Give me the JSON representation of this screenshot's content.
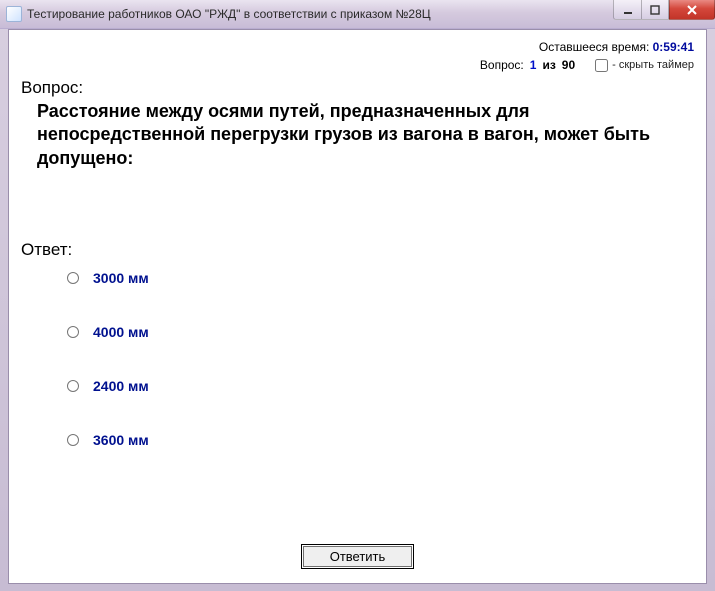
{
  "window": {
    "title": "Тестирование работников ОАО \"РЖД\" в соответствии с приказом №28Ц"
  },
  "meta": {
    "time_label": "Оставшееся время:",
    "time_value": "0:59:41",
    "question_label": "Вопрос:",
    "question_current": "1",
    "question_of": "из",
    "question_total": "90",
    "hide_timer_label": "- скрыть таймер",
    "hide_timer_checked": false
  },
  "question": {
    "label": "Вопрос:",
    "text": "Расстояние между осями путей, предназначенных для непосредственной перегрузки грузов из вагона в вагон, может быть допущено:"
  },
  "answer_label": "Ответ:",
  "answers": [
    {
      "text": "3000 мм"
    },
    {
      "text": "4000 мм"
    },
    {
      "text": "2400 мм"
    },
    {
      "text": "3600 мм"
    }
  ],
  "submit_label": "Ответить"
}
